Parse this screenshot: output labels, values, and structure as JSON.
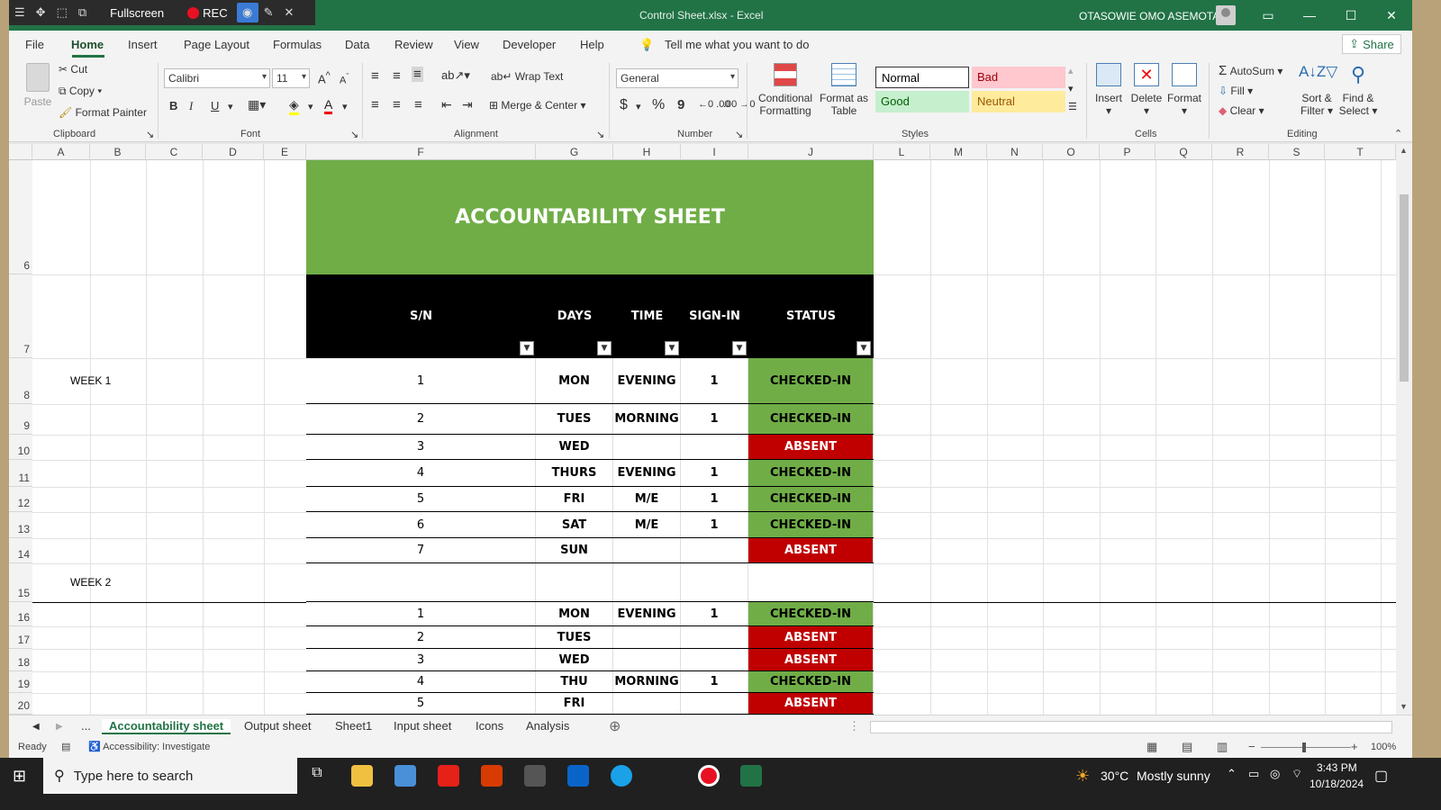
{
  "titlebar": {
    "fullscreen_label": "Fullscreen",
    "rec_label": "REC",
    "file_title": "Control Sheet.xlsx  -  Excel",
    "user_name": "OTASOWIE OMO ASEMOTA"
  },
  "menu": {
    "file": "File",
    "home": "Home",
    "insert": "Insert",
    "page_layout": "Page Layout",
    "formulas": "Formulas",
    "data": "Data",
    "review": "Review",
    "view": "View",
    "developer": "Developer",
    "help": "Help",
    "tell_me": "Tell me what you want to do",
    "share": "Share"
  },
  "ribbon": {
    "clipboard": {
      "paste": "Paste",
      "cut": "Cut",
      "copy": "Copy",
      "format_painter": "Format Painter",
      "label": "Clipboard"
    },
    "font": {
      "family": "Calibri",
      "size": "11",
      "label": "Font",
      "bold": "B",
      "italic": "I",
      "underline": "U"
    },
    "alignment": {
      "wrap_text": "Wrap Text",
      "merge_center": "Merge & Center",
      "label": "Alignment"
    },
    "number": {
      "format": "General",
      "label": "Number",
      "currency": "$",
      "percent": "%",
      "comma": "9"
    },
    "styles": {
      "conditional": "Conditional",
      "formatting": "Formatting",
      "format_as": "Format as",
      "table": "Table",
      "normal": "Normal",
      "bad": "Bad",
      "good": "Good",
      "neutral": "Neutral",
      "label": "Styles"
    },
    "cells": {
      "insert": "Insert",
      "delete": "Delete",
      "format": "Format",
      "label": "Cells"
    },
    "editing": {
      "autosum": "AutoSum",
      "fill": "Fill",
      "clear": "Clear",
      "sort_filter_1": "Sort &",
      "sort_filter_2": "Filter",
      "find_select_1": "Find &",
      "find_select_2": "Select",
      "label": "Editing"
    }
  },
  "columns": [
    "A",
    "B",
    "C",
    "D",
    "E",
    "F",
    "G",
    "H",
    "I",
    "J",
    "L",
    "M",
    "N",
    "O",
    "P",
    "Q",
    "R",
    "S",
    "T"
  ],
  "sheet": {
    "title": "ACCOUNTABILITY SHEET",
    "headers": {
      "sn": "S/N",
      "days": "DAYS",
      "time": "TIME",
      "signin": "SIGN-IN",
      "status": "STATUS"
    },
    "week1_label": "WEEK 1",
    "week2_label": "WEEK 2",
    "rows": [
      {
        "row": "8",
        "sn": "1",
        "day": "MON",
        "time": "EVENING",
        "signin": "1",
        "status": "CHECKED-IN",
        "ok": true
      },
      {
        "row": "9",
        "sn": "2",
        "day": "TUES",
        "time": "MORNING",
        "signin": "1",
        "status": "CHECKED-IN",
        "ok": true
      },
      {
        "row": "10",
        "sn": "3",
        "day": "WED",
        "time": "",
        "signin": "",
        "status": "ABSENT",
        "ok": false
      },
      {
        "row": "11",
        "sn": "4",
        "day": "THURS",
        "time": "EVENING",
        "signin": "1",
        "status": "CHECKED-IN",
        "ok": true
      },
      {
        "row": "12",
        "sn": "5",
        "day": "FRI",
        "time": "M/E",
        "signin": "1",
        "status": "CHECKED-IN",
        "ok": true
      },
      {
        "row": "13",
        "sn": "6",
        "day": "SAT",
        "time": "M/E",
        "signin": "1",
        "status": "CHECKED-IN",
        "ok": true
      },
      {
        "row": "14",
        "sn": "7",
        "day": "SUN",
        "time": "",
        "signin": "",
        "status": "ABSENT",
        "ok": false
      },
      {
        "row": "15",
        "sn": "",
        "day": "",
        "time": "",
        "signin": "",
        "status": "",
        "ok": null
      },
      {
        "row": "16",
        "sn": "1",
        "day": "MON",
        "time": "EVENING",
        "signin": "1",
        "status": "CHECKED-IN",
        "ok": true
      },
      {
        "row": "17",
        "sn": "2",
        "day": "TUES",
        "time": "",
        "signin": "",
        "status": "ABSENT",
        "ok": false
      },
      {
        "row": "18",
        "sn": "3",
        "day": "WED",
        "time": "",
        "signin": "",
        "status": "ABSENT",
        "ok": false
      },
      {
        "row": "19",
        "sn": "4",
        "day": "THU",
        "time": "MORNING",
        "signin": "1",
        "status": "CHECKED-IN",
        "ok": true
      },
      {
        "row": "20",
        "sn": "5",
        "day": "FRI",
        "time": "",
        "signin": "",
        "status": "ABSENT",
        "ok": false
      }
    ],
    "row_numbers": [
      "6",
      "7"
    ]
  },
  "tabs": {
    "more": "...",
    "active": "Accountability sheet",
    "t2": "Output sheet",
    "t3": "Sheet1",
    "t4": "Input sheet",
    "t5": "Icons",
    "t6": "Analysis"
  },
  "status": {
    "ready": "Ready",
    "accessibility": "Accessibility: Investigate",
    "zoom": "100%"
  },
  "taskbar": {
    "search": "Type here to search",
    "temp": "30°C",
    "weather": "Mostly sunny",
    "time": "3:43 PM",
    "date": "10/18/2024"
  },
  "colors": {
    "excel_green": "#217346",
    "checked": "#70ad47",
    "absent": "#c00000"
  }
}
